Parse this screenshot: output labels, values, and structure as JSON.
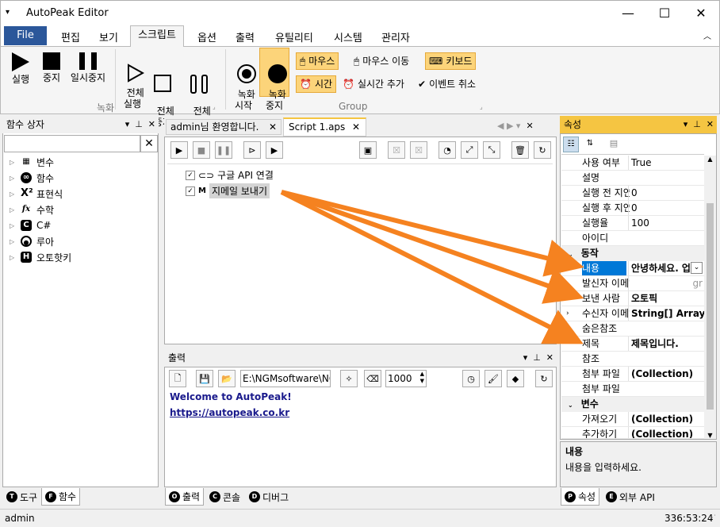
{
  "app": {
    "title": "AutoPeak Editor"
  },
  "menu": {
    "file": "File",
    "items": [
      "편집",
      "보기",
      "스크립트",
      "옵션",
      "출력",
      "유틸리티",
      "시스템",
      "관리자"
    ]
  },
  "ribbon": {
    "run": "실행",
    "stop": "중지",
    "pause": "일시중지",
    "run_all": "전체\n실행",
    "stop_all": "전체\n중지",
    "pause_all": "전체\n일시중지",
    "rec_start": "녹화\n시작",
    "rec_stop": "녹화\n중지",
    "group_record": "녹화",
    "group_group": "Group",
    "mouse": "마우스",
    "mouse_move": "마우스 이동",
    "keyboard": "키보드",
    "time": "시간",
    "realtime_add": "실시간 추가",
    "event_cancel": "이벤트 취소"
  },
  "function_box": {
    "title": "함수 상자",
    "search_value": "",
    "items": [
      "변수",
      "함수",
      "표현식",
      "수학",
      "C#",
      "루아",
      "오토핫키"
    ],
    "tabs": [
      "도구",
      "함수"
    ]
  },
  "editor": {
    "tabs": [
      "admin님 환영합니다.",
      "Script 1.aps"
    ],
    "nodes": [
      "구글 API 연결",
      "지메일 보내기"
    ]
  },
  "output": {
    "title": "출력",
    "path": "E:\\NGMsoftware\\NG",
    "font_size": "1000",
    "welcome": "Welcome to AutoPeak!",
    "link": "https://autopeak.co.kr",
    "tabs": [
      "출력",
      "콘솔",
      "디버그"
    ]
  },
  "properties": {
    "title": "속성",
    "rows": [
      {
        "k": "사용 여부",
        "v": "True"
      },
      {
        "k": "설명",
        "v": ""
      },
      {
        "k": "실행 전 지연",
        "v": "0"
      },
      {
        "k": "실행 후 지연",
        "v": "0"
      },
      {
        "k": "실행율",
        "v": "100"
      },
      {
        "k": "아이디",
        "v": ""
      }
    ],
    "cat_action": "동작",
    "action_rows": [
      {
        "k": "내용",
        "v": "안녕하세요. 업"
      },
      {
        "k": "발신자 이메일",
        "v": "gr"
      },
      {
        "k": "보낸 사람",
        "v": "오토픽"
      },
      {
        "k": "수신자 이메일",
        "v": "String[] Array"
      },
      {
        "k": "숨은참조",
        "v": ""
      },
      {
        "k": "제목",
        "v": "제목입니다."
      },
      {
        "k": "참조",
        "v": ""
      },
      {
        "k": "첨부 파일",
        "v": "(Collection)"
      },
      {
        "k": "첨부 파일",
        "v": ""
      }
    ],
    "cat_var": "변수",
    "var_rows": [
      {
        "k": "가져오기",
        "v": "(Collection)"
      },
      {
        "k": "추가하기",
        "v": "(Collection)"
      }
    ],
    "desc_title": "내용",
    "desc_text": "내용을 입력하세요.",
    "tabs": [
      "속성",
      "외부 API"
    ]
  },
  "status": {
    "user": "admin",
    "position": "336:53:24"
  },
  "colors": {
    "accent": "#2b579a",
    "highlight": "#fcd47a",
    "arrow": "#f58220"
  }
}
